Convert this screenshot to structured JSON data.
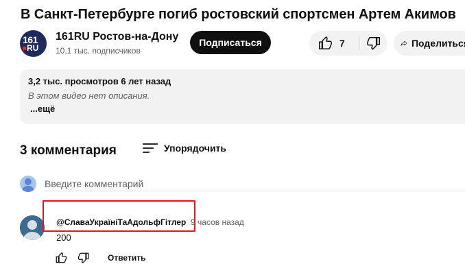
{
  "video": {
    "title": "В Санкт-Петербурге погиб ростовский спортсмен Артем Акимов"
  },
  "channel": {
    "logo_top": "161",
    "logo_bottom": "RU",
    "name": "161RU Ростов-на-Дону",
    "subscribers": "10,1 тыс. подписчиков",
    "subscribe_label": "Подписаться"
  },
  "actions": {
    "like_count": "7",
    "share_label": "Поделиться"
  },
  "description": {
    "stats": "3,2 тыс. просмотров  6 лет назад",
    "text": "В этом видео нет описания.",
    "more_label": "...ещё"
  },
  "comments": {
    "count_label": "3 комментария",
    "sort_label": "Упорядочить",
    "input_placeholder": "Введите комментарий",
    "items": [
      {
        "author": "@СлаваУкраїніТаАдольфГітлер",
        "time": "9 часов назад",
        "text": "200",
        "reply_label": "Ответить"
      }
    ]
  },
  "colors": {
    "highlight": "#e3161f",
    "button_dark": "#0f0f0f",
    "pill_bg": "#f2f2f2"
  }
}
